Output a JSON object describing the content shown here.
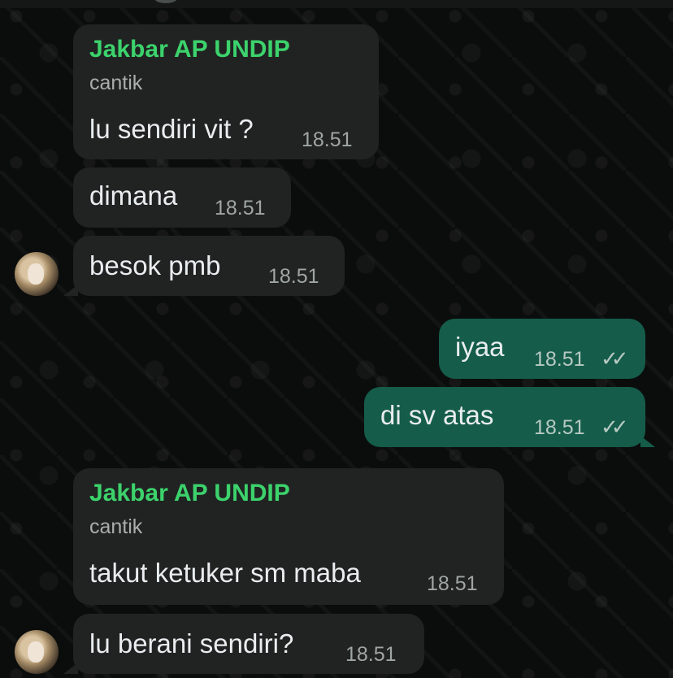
{
  "messages": [
    {
      "id": "m1",
      "sender": "Jakbar AP UNDIP",
      "sub": "cantik",
      "text": "lu sendiri vit ?",
      "time": "18.51"
    },
    {
      "id": "m2",
      "text": "dimana",
      "time": "18.51"
    },
    {
      "id": "m3",
      "text": "besok pmb",
      "time": "18.51"
    },
    {
      "id": "m4",
      "text": "iyaa",
      "time": "18.51",
      "status": "read"
    },
    {
      "id": "m5",
      "text": "di sv atas",
      "time": "18.51",
      "status": "read"
    },
    {
      "id": "m6",
      "sender": "Jakbar AP UNDIP",
      "sub": "cantik",
      "text": "takut ketuker sm maba",
      "time": "18.51"
    },
    {
      "id": "m7",
      "text": "lu berani sendiri?",
      "time": "18.51"
    }
  ],
  "colors": {
    "background": "#0b0d0c",
    "incoming_bubble": "#202322",
    "outgoing_bubble": "#155c4a",
    "sender_name": "#3cd26c"
  },
  "icons": {
    "read_receipt": "double-check-icon"
  }
}
